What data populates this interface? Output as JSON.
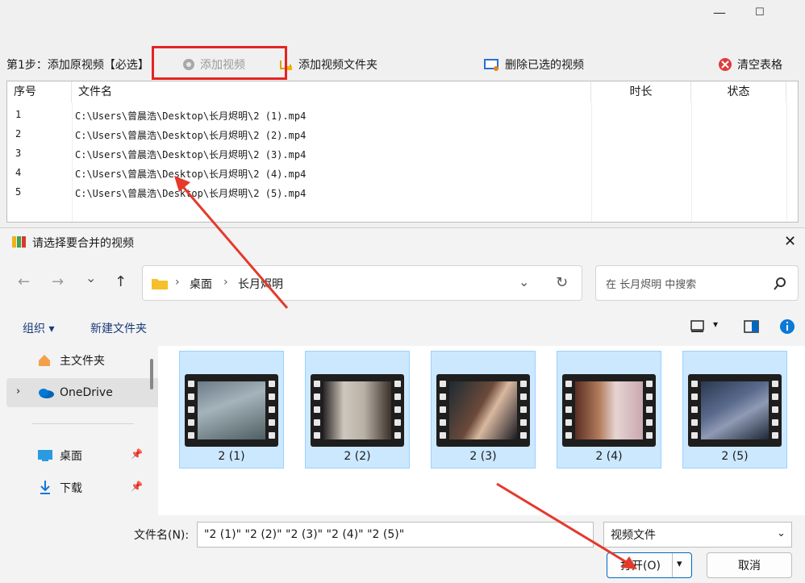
{
  "window": {
    "minimize_glyph": "—",
    "maximize_glyph": "☐"
  },
  "toolbar": {
    "step_label": "第1步：添加原视频【必选】",
    "add_video": "添加视频",
    "add_folder": "添加视频文件夹",
    "delete_selected": "删除已选的视频",
    "clear_table": "清空表格"
  },
  "table": {
    "headers": [
      "序号",
      "文件名",
      "时长",
      "状态"
    ],
    "rows": [
      {
        "index": "1",
        "file": "C:\\Users\\曾晨浩\\Desktop\\长月烬明\\2 (1).mp4"
      },
      {
        "index": "2",
        "file": "C:\\Users\\曾晨浩\\Desktop\\长月烬明\\2 (2).mp4"
      },
      {
        "index": "3",
        "file": "C:\\Users\\曾晨浩\\Desktop\\长月烬明\\2 (3).mp4"
      },
      {
        "index": "4",
        "file": "C:\\Users\\曾晨浩\\Desktop\\长月烬明\\2 (4).mp4"
      },
      {
        "index": "5",
        "file": "C:\\Users\\曾晨浩\\Desktop\\长月烬明\\2 (5).mp4"
      }
    ]
  },
  "dialog": {
    "title": "请选择要合并的视频",
    "close_glyph": "✕",
    "nav": {
      "back": "←",
      "forward": "→",
      "recent": "⌄",
      "up": "↑"
    },
    "breadcrumb": [
      "桌面",
      "长月烬明"
    ],
    "search_placeholder": "在 长月烬明 中搜索",
    "cmd": {
      "organize": "组织 ▾",
      "new_folder": "新建文件夹"
    },
    "sidebar": [
      {
        "label": "主文件夹",
        "icon": "home-icon"
      },
      {
        "label": "OneDrive",
        "icon": "cloud-icon"
      },
      {
        "label": "桌面",
        "icon": "desktop-icon"
      },
      {
        "label": "下载",
        "icon": "download-icon"
      }
    ],
    "files": [
      "2 (1)",
      "2 (2)",
      "2 (3)",
      "2 (4)",
      "2 (5)"
    ],
    "filename_label": "文件名(N):",
    "filename_value": "\"2 (1)\" \"2 (2)\" \"2 (3)\" \"2 (4)\" \"2 (5)\"",
    "filetype": "视频文件",
    "open_button": "打开(O)",
    "cancel_button": "取消"
  },
  "colors": {
    "highlight_red": "#e42424",
    "tile_selected": "#cce8ff",
    "accent_blue": "#0067c0"
  }
}
